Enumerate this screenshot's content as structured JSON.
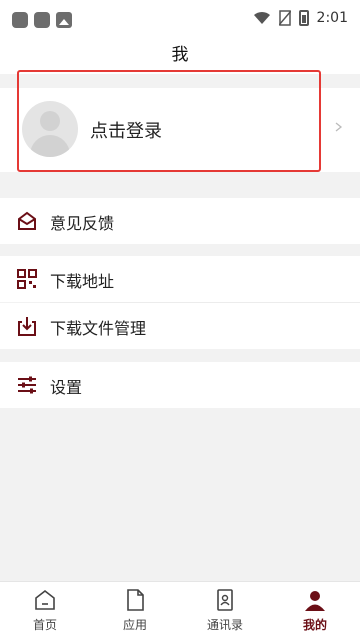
{
  "status_bar": {
    "time": "2:01"
  },
  "page": {
    "title": "我"
  },
  "profile": {
    "login_label": "点击登录"
  },
  "menu": {
    "feedback": "意见反馈",
    "download_address": "下载地址",
    "download_manager": "下载文件管理",
    "settings": "设置"
  },
  "bottom_nav": [
    {
      "label": "首页",
      "icon": "home-icon"
    },
    {
      "label": "应用",
      "icon": "document-icon"
    },
    {
      "label": "通讯录",
      "icon": "contacts-icon"
    },
    {
      "label": "我的",
      "icon": "user-icon",
      "active": true
    }
  ],
  "colors": {
    "accent": "#6b0f16",
    "highlight_border": "#e53935",
    "background": "#f2f2f2"
  }
}
